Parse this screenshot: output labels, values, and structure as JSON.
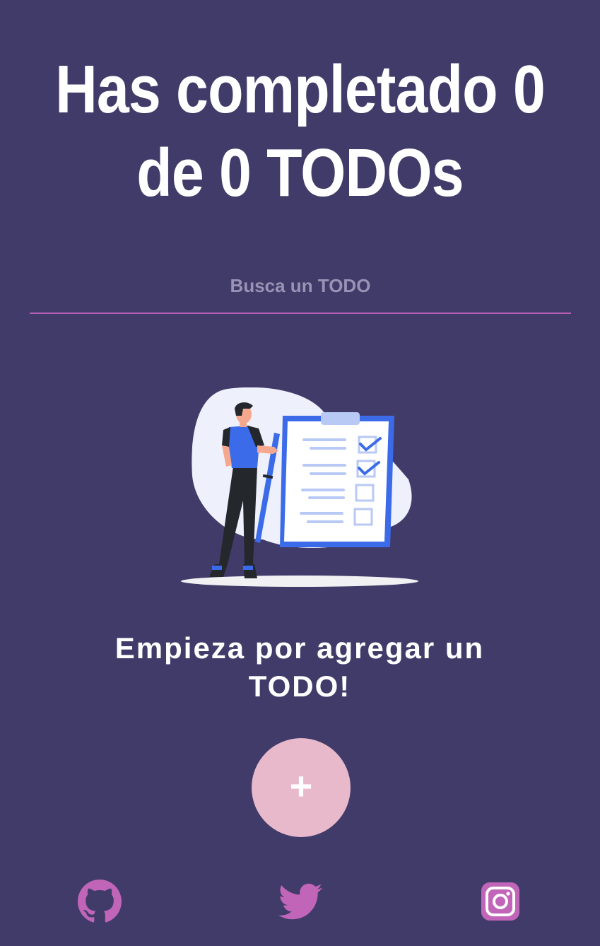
{
  "header": {
    "title": "Has completado 0 de 0 TODOs"
  },
  "search": {
    "placeholder": "Busca un TODO",
    "value": ""
  },
  "empty_state": {
    "illustration": "person-with-checklist-illustration",
    "message": "Empieza por agregar un TODO!"
  },
  "add_button": {
    "label": "+"
  },
  "footer": {
    "links": [
      {
        "icon": "github-icon"
      },
      {
        "icon": "twitter-icon"
      },
      {
        "icon": "instagram-icon"
      }
    ]
  },
  "colors": {
    "background": "#413b69",
    "accent": "#b55fb4",
    "add_button": "#e8b8cb",
    "illustration_blue": "#3b6be8"
  }
}
